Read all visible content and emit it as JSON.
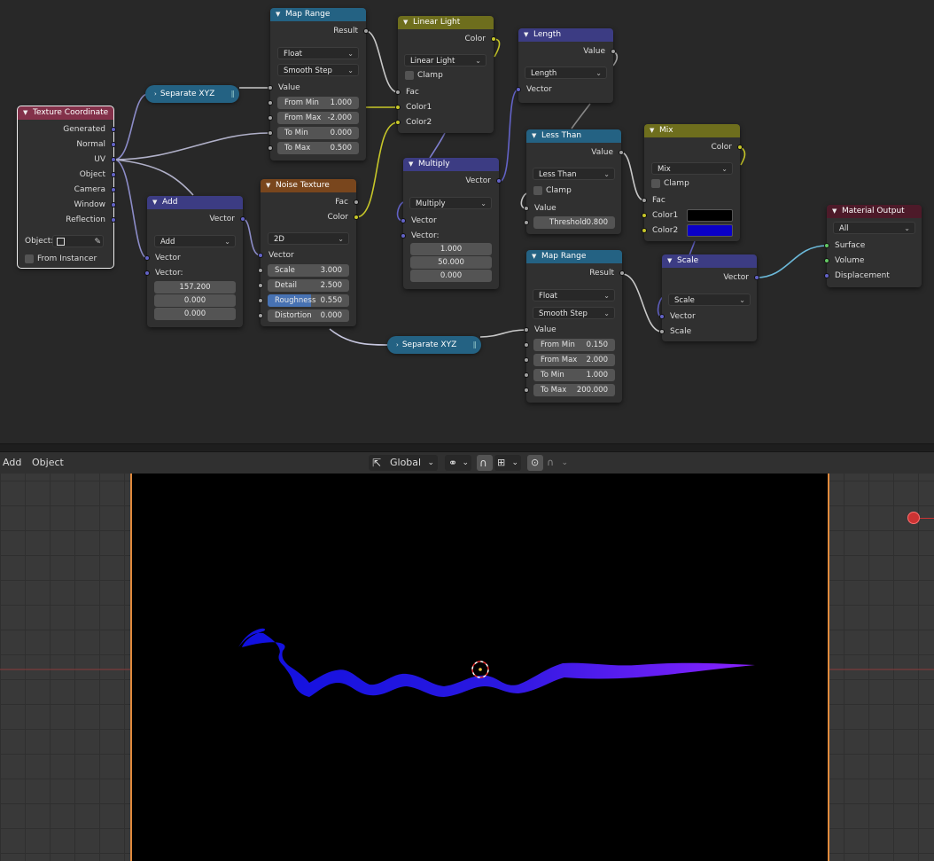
{
  "nodes": {
    "texture_coordinate": {
      "title": "Texture Coordinate",
      "outputs": [
        "Generated",
        "Normal",
        "UV",
        "Object",
        "Camera",
        "Window",
        "Reflection"
      ],
      "object_label": "Object:",
      "from_instancer": "From Instancer"
    },
    "separate_xyz_top": {
      "title": "Separate XYZ"
    },
    "map_range_top": {
      "title": "Map Range",
      "output": "Result",
      "data_type": "Float",
      "interpolation": "Smooth Step",
      "value_label": "Value",
      "fields": [
        {
          "label": "From Min",
          "value": "1.000"
        },
        {
          "label": "From Max",
          "value": "-2.000"
        },
        {
          "label": "To Min",
          "value": "0.000"
        },
        {
          "label": "To Max",
          "value": "0.500"
        }
      ]
    },
    "add": {
      "title": "Add",
      "output": "Vector",
      "operation": "Add",
      "input1": "Vector",
      "input2": "Vector:",
      "values": [
        "157.200",
        "0.000",
        "0.000"
      ]
    },
    "noise_texture": {
      "title": "Noise Texture",
      "outputs": [
        "Fac",
        "Color"
      ],
      "dimensions": "2D",
      "vector_label": "Vector",
      "fields": [
        {
          "label": "Scale",
          "value": "3.000"
        },
        {
          "label": "Detail",
          "value": "2.500"
        },
        {
          "label": "Roughness",
          "value": "0.550"
        },
        {
          "label": "Distortion",
          "value": "0.000"
        }
      ]
    },
    "linear_light": {
      "title": "Linear Light",
      "output": "Color",
      "blend_mode": "Linear Light",
      "clamp": "Clamp",
      "inputs": [
        "Fac",
        "Color1",
        "Color2"
      ]
    },
    "multiply": {
      "title": "Multiply",
      "output": "Vector",
      "operation": "Multiply",
      "input1": "Vector",
      "input2": "Vector:",
      "values": [
        "1.000",
        "50.000",
        "0.000"
      ]
    },
    "length": {
      "title": "Length",
      "output": "Value",
      "operation": "Length",
      "input": "Vector"
    },
    "less_than": {
      "title": "Less Than",
      "output": "Value",
      "operation": "Less Than",
      "clamp": "Clamp",
      "value_label": "Value",
      "threshold_label": "Threshold",
      "threshold_value": "0.800"
    },
    "mix": {
      "title": "Mix",
      "output": "Color",
      "blend_mode": "Mix",
      "clamp": "Clamp",
      "inputs": [
        "Fac",
        "Color1",
        "Color2"
      ],
      "color1": "#000000",
      "color2": "#0a00c8"
    },
    "material_output": {
      "title": "Material Output",
      "target": "All",
      "inputs": [
        "Surface",
        "Volume",
        "Displacement"
      ]
    },
    "separate_xyz_bottom": {
      "title": "Separate XYZ"
    },
    "map_range_bottom": {
      "title": "Map Range",
      "output": "Result",
      "data_type": "Float",
      "interpolation": "Smooth Step",
      "value_label": "Value",
      "fields": [
        {
          "label": "From Min",
          "value": "0.150"
        },
        {
          "label": "From Max",
          "value": "2.000"
        },
        {
          "label": "To Min",
          "value": "1.000"
        },
        {
          "label": "To Max",
          "value": "200.000"
        }
      ]
    },
    "scale": {
      "title": "Scale",
      "output": "Vector",
      "operation": "Scale",
      "inputs": [
        "Vector",
        "Scale"
      ]
    }
  },
  "viewport_header": {
    "menu_add": "Add",
    "menu_object": "Object",
    "orientation": "Global"
  },
  "colors": {
    "vector_socket": "#6363c7",
    "float_socket": "#a1a1a1",
    "color_socket": "#c7c729",
    "shader_socket": "#63c763",
    "camera_border": "#e08a3d"
  }
}
